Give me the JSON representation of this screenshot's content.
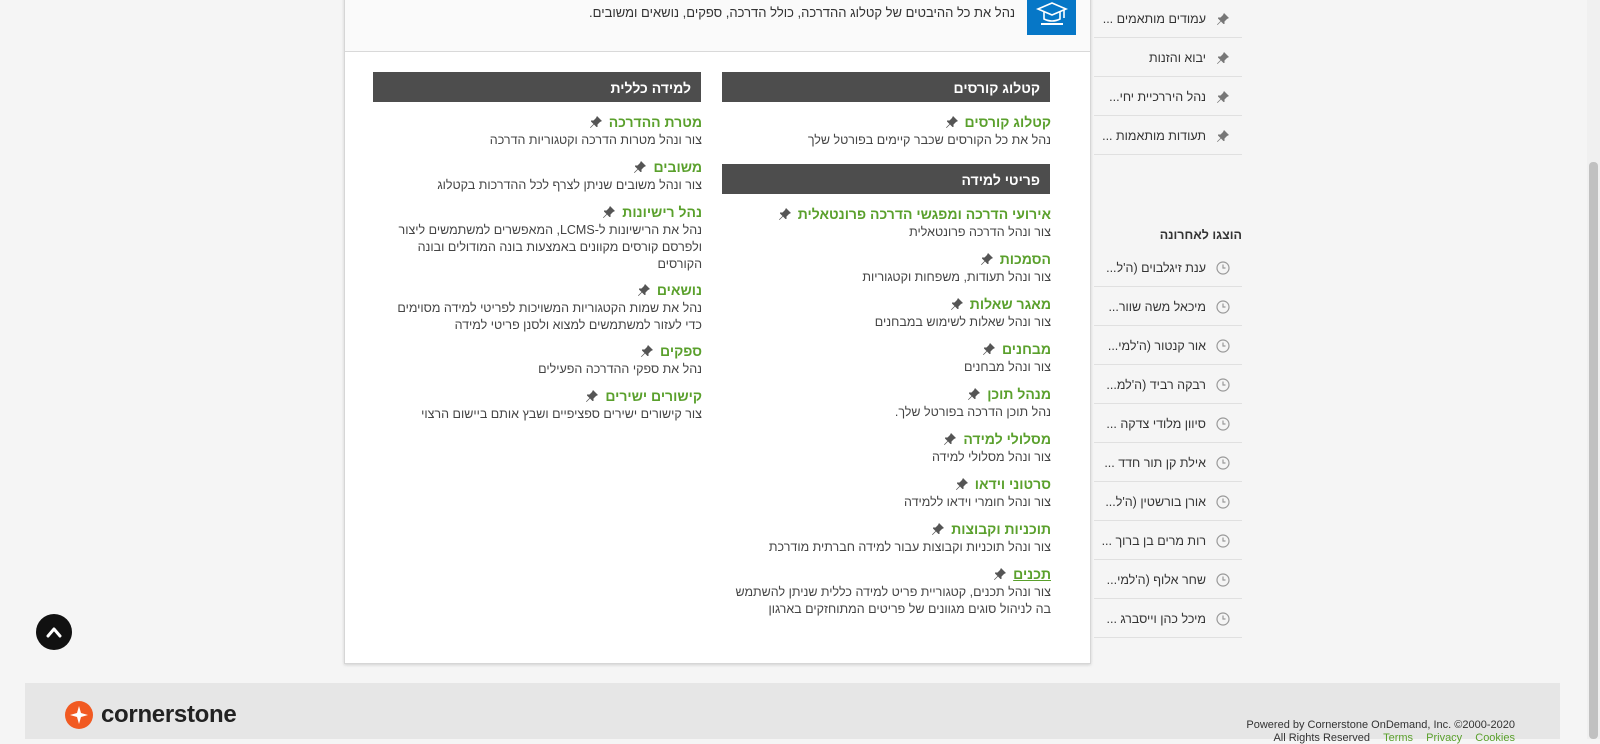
{
  "header": {
    "catalog_description": "נהל את כל ההיבטים של קטלוג ההדרכה, כולל הדרכה, ספקים, נושאים ומשובים."
  },
  "sections": {
    "course_catalog": {
      "title": "קטלוג קורסים",
      "items": [
        {
          "title": "קטלוג קורסים",
          "desc": "נהל את כל הקורסים שכבר קיימים בפורטל שלך"
        }
      ]
    },
    "learning_objects": {
      "title": "פריטי למידה",
      "items": [
        {
          "title": "אירועי הדרכה ומפגשי הדרכה פרונטאלית",
          "desc": "צור ונהל הדרכה פרונטאלית"
        },
        {
          "title": "הסמכות",
          "desc": "צור ונהל תעודות, משפחות וקטגוריות"
        },
        {
          "title": "מאגר שאלות",
          "desc": "צור ונהל שאלות לשימוש במבחנים"
        },
        {
          "title": "מבחנים",
          "desc": "צור ונהל מבחנים"
        },
        {
          "title": "מנהל תוכן",
          "desc": "נהל תוכן הדרכה בפורטל שלך."
        },
        {
          "title": "מסלולי למידה",
          "desc": "צור ונהל מסלולי למידה"
        },
        {
          "title": "סרטוני וידאו",
          "desc": "צור ונהל חומרי וידאו ללמידה"
        },
        {
          "title": "תוכניות וקבוצות",
          "desc": "צור ונהל תוכניות וקבוצות עבור למידה חברתית מודרכת"
        },
        {
          "title": "תכנים",
          "desc": "צור ונהל תכנים, קטגוריית פריט למידה כללית שניתן להשתמש בה לניהול סוגים מגוונים של פריטים המתוחזקים בארגון"
        }
      ]
    },
    "general_learning": {
      "title": "למידה כללית",
      "items": [
        {
          "title": "מטרת ההדרכה",
          "desc": "צור ונהל מטרות הדרכה וקטגוריות הדרכה"
        },
        {
          "title": "משובים",
          "desc": "צור ונהל משובים שניתן לצרף לכל ההדרכות בקטלוג"
        },
        {
          "title": "נהל רישיונות",
          "desc": "נהל את הרישיונות ל-LCMS, המאפשרים למשתמשים ליצור ולפרסם קורסים מקוונים באמצעות בונה המודולים ובונה הקורסים"
        },
        {
          "title": "נושאים",
          "desc": "נהל את שמות הקטגוריות המשויכות לפריטי למידה מסוימים כדי לעזור למשתמשים למצוא ולסנן פריטי למידה"
        },
        {
          "title": "ספקים",
          "desc": "נהל את ספקי ההדרכה הפעילים"
        },
        {
          "title": "קישורים ישירים",
          "desc": "צור קישורים ישירים ספציפיים ושבץ אותם ביישום הרצוי"
        }
      ]
    }
  },
  "sidebar": {
    "pinned": [
      {
        "label": "עמודים מותאמים ..."
      },
      {
        "label": "יבוא והזנות"
      },
      {
        "label": "נהל היררכיית יחי..."
      },
      {
        "label": "תעודות מותאמות ..."
      }
    ],
    "recent_title": "הוצגו לאחרונה",
    "recent": [
      {
        "label": "ענת זיגלבוים (ה'ל..."
      },
      {
        "label": "מיכאל משה שוור..."
      },
      {
        "label": "אור קנטור (ה'למי..."
      },
      {
        "label": "רבקה רביד (ה'למ..."
      },
      {
        "label": "סיוון מלודי צדקה ..."
      },
      {
        "label": "אילת קן תור חדד ..."
      },
      {
        "label": "אורן בורשטין (ה'ל..."
      },
      {
        "label": "רות מרים בן ברוך ..."
      },
      {
        "label": "שחר אלוף (ה'למי..."
      },
      {
        "label": "מיכל כהן וייסברג ..."
      }
    ]
  },
  "footer": {
    "logo_text": "cornerstone",
    "powered_by": "Powered by Cornerstone OnDemand, Inc. ©2000-2020",
    "rights": "All Rights Reserved",
    "links": [
      "Terms",
      "Privacy",
      "Cookies"
    ]
  },
  "colors": {
    "accent": "#5aa02c",
    "header_bar": "#4d4d4d",
    "catalog_icon_bg": "#0677c7",
    "logo_orange": "#f15a22"
  },
  "icons": {
    "pin": "pin-icon",
    "recent": "clock-icon",
    "catalog": "graduation-cap-icon",
    "scroll_top": "chevron-up-icon"
  }
}
